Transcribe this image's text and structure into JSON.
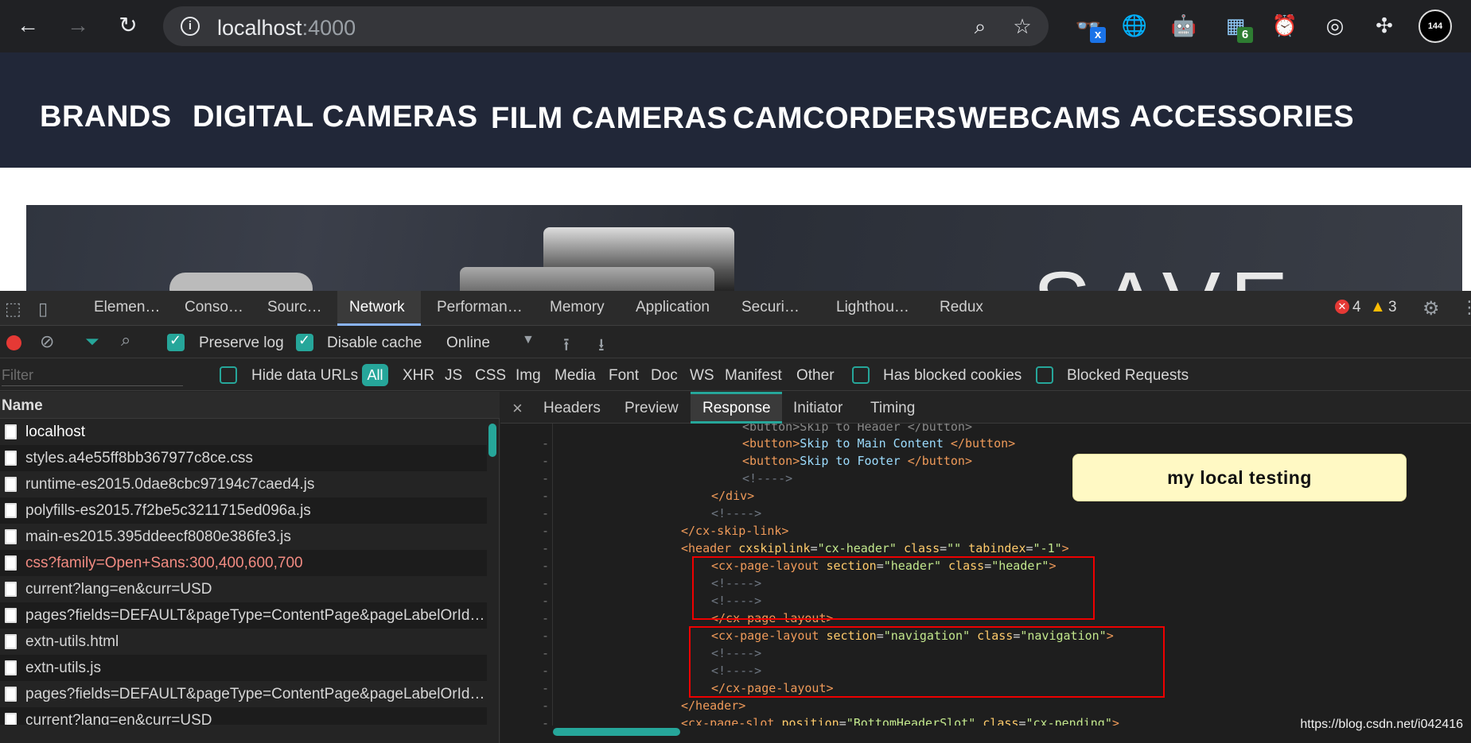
{
  "browser": {
    "url_host": "localhost",
    "url_port": ":4000",
    "profile_badge": "144",
    "ext_badge_x": "x",
    "ext_badge_count": "6"
  },
  "site_nav": {
    "categories": [
      "BRANDS",
      "DIGITAL CAMERAS",
      "FILM CAMERAS",
      "CAMCORDERS",
      "WEBCAMS",
      "ACCESSORIES"
    ]
  },
  "banner": {
    "text": "SAVE"
  },
  "devtools": {
    "tabs": [
      "Elemen…",
      "Conso…",
      "Sourc…",
      "Network",
      "Performan…",
      "Memory",
      "Application",
      "Securi…",
      "Lighthou…",
      "Redux"
    ],
    "active_tab": "Network",
    "errors": "4",
    "warnings": "3",
    "toolbar": {
      "preserve_log": "Preserve log",
      "disable_cache": "Disable cache",
      "throttle": "Online"
    },
    "filterbar": {
      "placeholder": "Filter",
      "hide_data_urls": "Hide data URLs",
      "types": [
        "All",
        "XHR",
        "JS",
        "CSS",
        "Img",
        "Media",
        "Font",
        "Doc",
        "WS",
        "Manifest",
        "Other"
      ],
      "has_blocked_cookies": "Has blocked cookies",
      "blocked_requests": "Blocked Requests"
    },
    "requests": {
      "header": "Name",
      "rows": [
        "localhost",
        "styles.a4e55ff8bb367977c8ce.css",
        "runtime-es2015.0dae8cbc97194c7caed4.js",
        "polyfills-es2015.7f2be5c3211715ed096a.js",
        "main-es2015.395ddeecf8080e386fe3.js",
        "css?family=Open+Sans:300,400,600,700",
        "current?lang=en&curr=USD",
        "pages?fields=DEFAULT&pageType=ContentPage&pageLabelOrId=ho…",
        "extn-utils.html",
        "extn-utils.js",
        "pages?fields=DEFAULT&pageType=ContentPage&pageLabelOrId=ho…",
        "current?lang=en&curr=USD"
      ]
    },
    "detail_tabs": [
      "Headers",
      "Preview",
      "Response",
      "Initiator",
      "Timing"
    ],
    "active_detail_tab": "Response"
  },
  "sticky_note": "my local testing",
  "watermark": "https://blog.csdn.net/i042416"
}
